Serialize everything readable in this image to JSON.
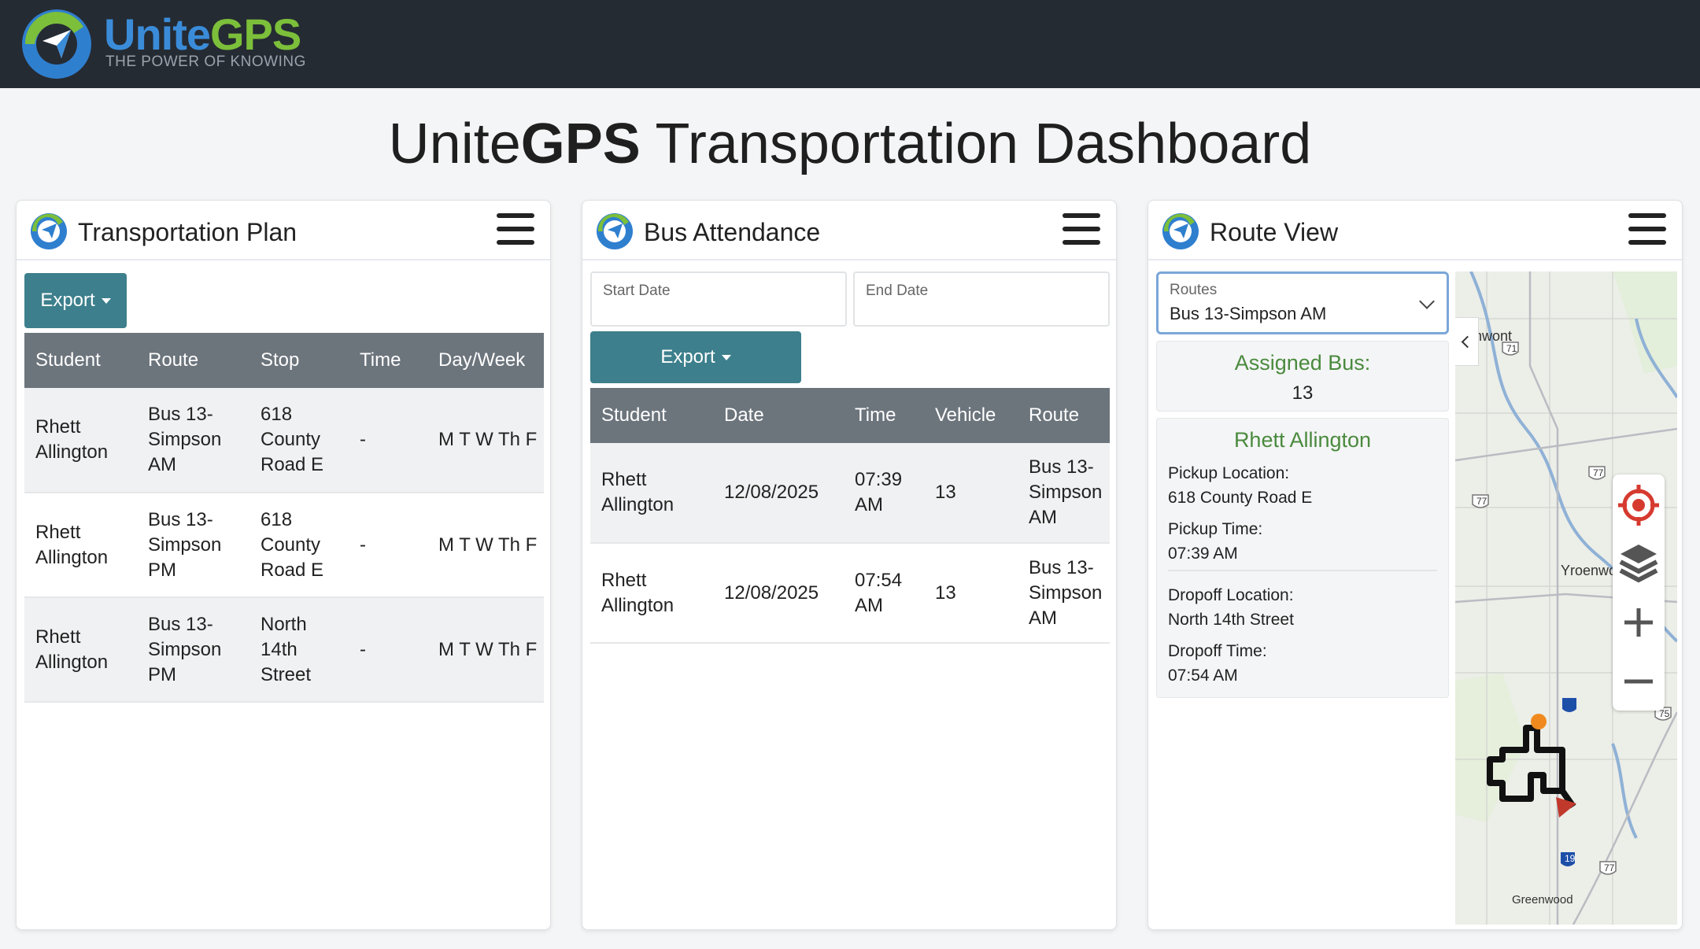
{
  "brand": {
    "name_part1": "Unite",
    "name_part2": "GPS",
    "tagline": "THE POWER OF KNOWING",
    "colors": {
      "blue": "#3a8cd9",
      "green": "#7cbf3a",
      "header_bg": "#252b33",
      "accent_teal": "#3d7f8c"
    }
  },
  "page": {
    "title_prefix": "Unite",
    "title_bold": "GPS",
    "title_suffix": " Transportation Dashboard"
  },
  "plan": {
    "title": "Transportation Plan",
    "export_label": "Export",
    "columns": [
      "Student",
      "Route",
      "Stop",
      "Time",
      "Day/Week"
    ],
    "rows": [
      {
        "student": "Rhett Allington",
        "route": "Bus 13-Simpson AM",
        "stop": "618 County Road E",
        "time": "-",
        "days": "M T W Th F"
      },
      {
        "student": "Rhett Allington",
        "route": "Bus 13-Simpson PM",
        "stop": "618 County Road E",
        "time": "-",
        "days": "M T W Th F"
      },
      {
        "student": "Rhett Allington",
        "route": "Bus 13-Simpson PM",
        "stop": "North 14th Street",
        "time": "-",
        "days": "M T W Th F"
      }
    ]
  },
  "attendance": {
    "title": "Bus Attendance",
    "start_date_label": "Start Date",
    "end_date_label": "End Date",
    "export_label": "Export",
    "columns": [
      "Student",
      "Date",
      "Time",
      "Vehicle",
      "Route"
    ],
    "rows": [
      {
        "student": "Rhett Allington",
        "date": "12/08/2025",
        "time": "07:39 AM",
        "vehicle": "13",
        "route": "Bus 13-Simpson AM"
      },
      {
        "student": "Rhett Allington",
        "date": "12/08/2025",
        "time": "07:54 AM",
        "vehicle": "13",
        "route": "Bus 13-Simpson AM"
      }
    ]
  },
  "route_view": {
    "title": "Route View",
    "routes_label": "Routes",
    "selected_route": "Bus 13-Simpson AM",
    "assigned_bus_label": "Assigned Bus:",
    "assigned_bus": "13",
    "student_name": "Rhett Allington",
    "pickup_location_label": "Pickup Location:",
    "pickup_location": "618 County Road E",
    "pickup_time_label": "Pickup Time:",
    "pickup_time": "07:39 AM",
    "dropoff_location_label": "Dropoff Location:",
    "dropoff_location": "North 14th Street",
    "dropoff_time_label": "Dropoff Time:",
    "dropoff_time": "07:54 AM",
    "map": {
      "labels": {
        "town1": "nwont",
        "town2": "Yroenwo",
        "town3": "Greenwood"
      },
      "shields": {
        "s71": "71",
        "s77a": "77",
        "s77b": "77",
        "s77c": "77",
        "s19": "19",
        "s75": "75"
      },
      "icons": [
        "locate-icon",
        "layers-icon",
        "zoom-in-icon",
        "zoom-out-icon"
      ]
    }
  }
}
